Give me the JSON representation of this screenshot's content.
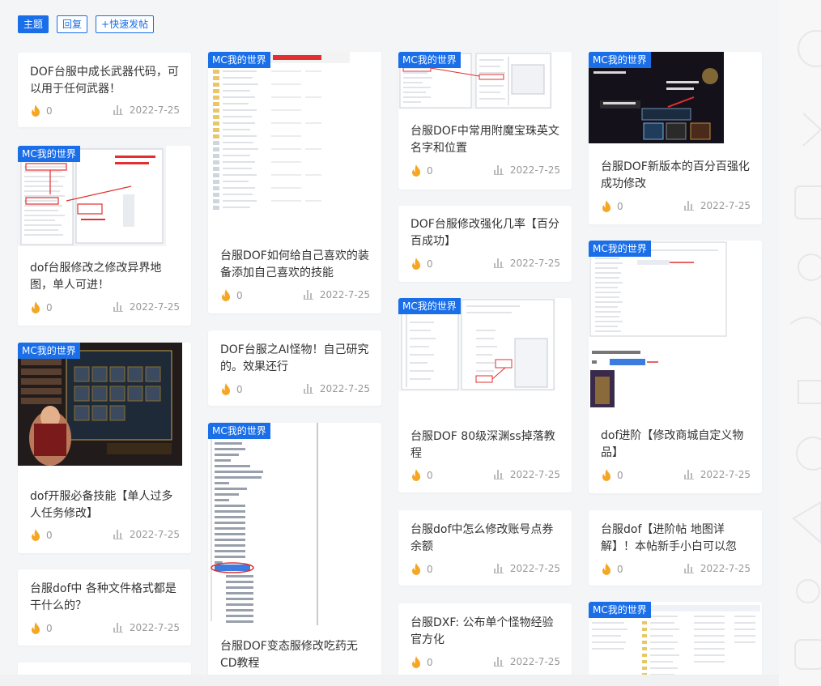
{
  "tabs": [
    {
      "label": "主题",
      "active": true
    },
    {
      "label": "回复",
      "active": false
    },
    {
      "label": "+快速发帖",
      "active": false
    }
  ],
  "category_label": "MC我的世界",
  "accent_color": "#1a6ee8",
  "flame_color": "#f5a623",
  "icons": {
    "like": "flame-icon",
    "views": "bar-chart-icon"
  },
  "posts": [
    {
      "title": "DOF台服中成长武器代码，可以用于任何武器！",
      "likes": "0",
      "date": "2022-7-25"
    },
    {
      "title": "dof台服修改之修改异界地图，单人可进！",
      "likes": "0",
      "date": "2022-7-25"
    },
    {
      "title": "dof开服必备技能【单人过多人任务修改】",
      "likes": "0",
      "date": "2022-7-25"
    },
    {
      "title": "台服dof中 各种文件格式都是干什么的？",
      "likes": "0",
      "date": "2022-7-25"
    },
    {
      "title": "台服DOF如何给自己喜欢的装备添加自己喜欢的技能",
      "likes": "0",
      "date": "2022-7-25"
    },
    {
      "title": "DOF台服之AI怪物！自己研究的。效果还行",
      "likes": "0",
      "date": "2022-7-25"
    },
    {
      "title": "台服DOF变态服修改吃药无CD教程",
      "likes": "",
      "date": ""
    },
    {
      "title": "台服DOF中常用附魔宝珠英文名字和位置",
      "likes": "0",
      "date": "2022-7-25"
    },
    {
      "title": "DOF台服修改强化几率【百分百成功】",
      "likes": "0",
      "date": "2022-7-25"
    },
    {
      "title": "台服DOF 80级深渊ss掉落教程",
      "likes": "0",
      "date": "2022-7-25"
    },
    {
      "title": "台服dof中怎么修改账号点券余额",
      "likes": "0",
      "date": "2022-7-25"
    },
    {
      "title": "台服DXF: 公布单个怪物经验官方化",
      "likes": "0",
      "date": "2022-7-25"
    },
    {
      "title": "台服DOF新版本的百分百强化成功修改",
      "likes": "0",
      "date": "2022-7-25"
    },
    {
      "title": "dof进阶【修改商城自定义物品】",
      "likes": "0",
      "date": "2022-7-25"
    },
    {
      "title": "台服dof【进阶帖 地图详解】！本帖新手小白可以忽",
      "likes": "0",
      "date": "2022-7-25"
    },
    {
      "title": "",
      "likes": "",
      "date": ""
    }
  ]
}
